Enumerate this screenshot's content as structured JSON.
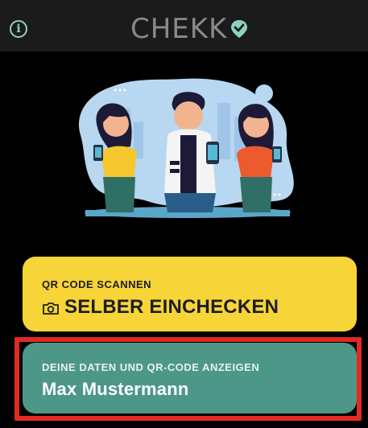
{
  "header": {
    "logo_text": "CHEKK",
    "info_icon": "info-icon",
    "logo_mark_icon": "location-check-icon"
  },
  "illustration": {
    "icon": "people-with-phones-illustration"
  },
  "scan_card": {
    "label": "QR CODE SCANNEN",
    "action": "SELBER EINCHECKEN",
    "icon": "camera-icon"
  },
  "data_card": {
    "label": "DEINE DATEN UND QR-CODE ANZEIGEN",
    "name": "Max Mustermann"
  },
  "colors": {
    "background": "#000000",
    "header": "#1b1b1b",
    "accent_green": "#8fd1c2",
    "scan_card": "#f7d438",
    "data_card": "#4d9788",
    "highlight": "#e12a22"
  }
}
